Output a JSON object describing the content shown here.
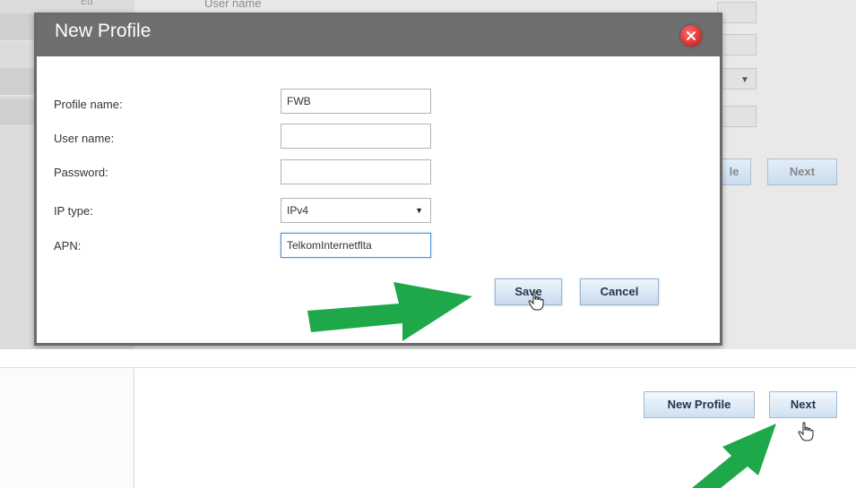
{
  "background_page": {
    "peek_label": "User name",
    "peek_tab": "Ed",
    "new_profile_partial": "le",
    "next_label": "Next"
  },
  "dialog": {
    "title": "New Profile",
    "fields": {
      "profile_name": {
        "label": "Profile name:",
        "value": "FWB"
      },
      "user_name": {
        "label": "User name:",
        "value": ""
      },
      "password": {
        "label": "Password:",
        "value": ""
      },
      "ip_type": {
        "label": "IP type:",
        "value": "IPv4"
      },
      "apn": {
        "label": "APN:",
        "value": "TelkomInternetflta"
      }
    },
    "save_label": "Save",
    "cancel_label": "Cancel"
  },
  "bottom": {
    "new_profile_label": "New Profile",
    "next_label": "Next"
  },
  "colors": {
    "dialog_header": "#6f6f6f",
    "pointer_arrow": "#1ea84a",
    "button_gradient_top": "#eef5fc",
    "button_gradient_bottom": "#c8daee"
  }
}
